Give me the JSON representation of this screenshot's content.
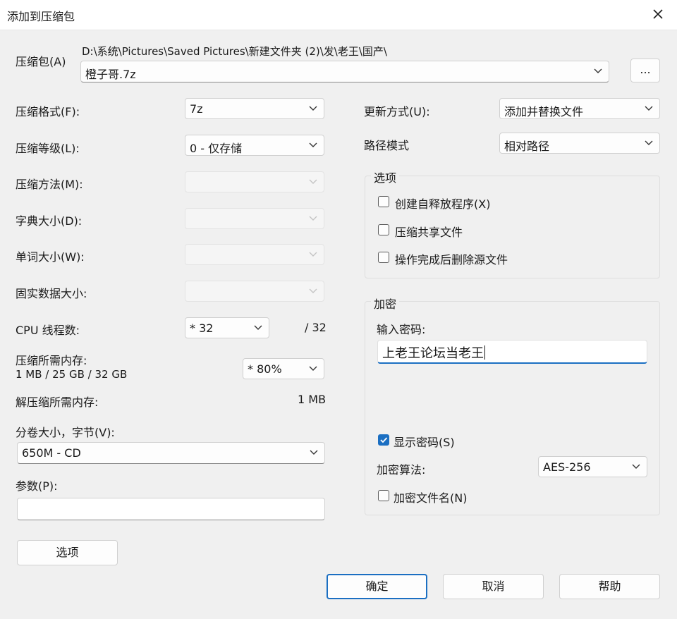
{
  "window": {
    "title": "添加到压缩包"
  },
  "archive": {
    "label": "压缩包(A)",
    "path": "D:\\系统\\Pictures\\Saved Pictures\\新建文件夹 (2)\\发\\老王\\国产\\",
    "filename": "橙子哥.7z",
    "browse_label": "..."
  },
  "left": {
    "format": {
      "label": "压缩格式(F):",
      "value": "7z"
    },
    "level": {
      "label": "压缩等级(L):",
      "value": "0 - 仅存储"
    },
    "method": {
      "label": "压缩方法(M):",
      "value": ""
    },
    "dict": {
      "label": "字典大小(D):",
      "value": ""
    },
    "word": {
      "label": "单词大小(W):",
      "value": ""
    },
    "solid": {
      "label": "固实数据大小:",
      "value": ""
    },
    "threads": {
      "label": "CPU 线程数:",
      "value": "* 32",
      "max": "/ 32"
    },
    "memory": {
      "label": "压缩所需内存:",
      "detail": "1 MB / 25 GB / 32 GB",
      "value": "* 80%"
    },
    "decompress": {
      "label": "解压缩所需内存:",
      "value": "1 MB"
    },
    "volume": {
      "label": "分卷大小，字节(V):",
      "value": "650M - CD"
    },
    "params": {
      "label": "参数(P):",
      "value": ""
    },
    "options_button": "选项"
  },
  "right": {
    "update": {
      "label": "更新方式(U):",
      "value": "添加并替换文件"
    },
    "pathmode": {
      "label": "路径模式",
      "value": "相对路径"
    },
    "options_group": {
      "title": "选项",
      "sfx": "创建自释放程序(X)",
      "shared": "压缩共享文件",
      "delete": "操作完成后删除源文件"
    },
    "encryption": {
      "title": "加密",
      "password_label": "输入密码:",
      "password": "上老王论坛当老王",
      "show_password": "显示密码(S)",
      "method_label": "加密算法:",
      "method": "AES-256",
      "encrypt_names": "加密文件名(N)"
    }
  },
  "buttons": {
    "ok": "确定",
    "cancel": "取消",
    "help": "帮助"
  },
  "colors": {
    "accent": "#1b6fc2",
    "background": "#f0f0f0"
  }
}
